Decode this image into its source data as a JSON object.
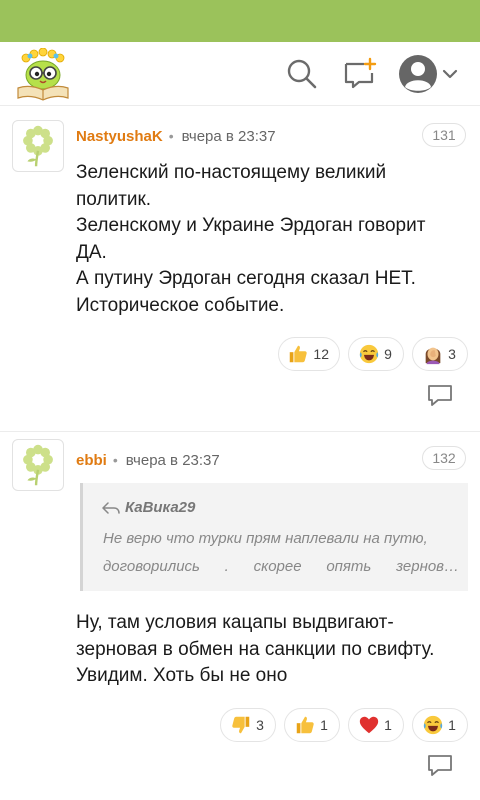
{
  "colors": {
    "top_strip": "#9bc25b",
    "author": "#e07b12",
    "muted": "#888888"
  },
  "header": {
    "logo_icon": "owl-book-logo",
    "search_icon": "search-icon",
    "new_post_icon": "chat-plus-icon",
    "profile_icon": "user-avatar-icon",
    "menu_icon": "chevron-down-icon"
  },
  "comments": [
    {
      "avatar_icon": "flower-avatar",
      "author": "NastyushaK",
      "separator": "•",
      "time": "вчера в 23:37",
      "number": "131",
      "text_lines": [
        "Зеленский по-настоящему великий",
        "политик.",
        "Зеленскому и Украине Эрдоган говорит",
        "ДА.",
        "А путину Эрдоган сегодня сказал НЕТ.",
        "Историческое событие."
      ],
      "reactions": [
        {
          "icon": "thumbs-up-emoji",
          "count": "12"
        },
        {
          "icon": "laughing-emoji",
          "count": "9"
        },
        {
          "icon": "facepalm-emoji",
          "count": "3"
        }
      ],
      "reply_icon": "reply-bubble-icon"
    },
    {
      "avatar_icon": "flower-avatar",
      "author": "ebbi",
      "separator": "•",
      "time": "вчера в 23:37",
      "number": "132",
      "quote": {
        "icon": "reply-arrow-icon",
        "author": "КаВика29",
        "lines": [
          "Не верю что турки прям наплевали на путю,",
          "договорились  .  скорее  опять  зернов…"
        ]
      },
      "text_lines": [
        "Ну, там условия кацапы выдвигают-",
        "зерновая в обмен на санкции по свифту.",
        "Увидим. Хоть бы не оно"
      ],
      "reactions": [
        {
          "icon": "thumbs-down-emoji",
          "count": "3"
        },
        {
          "icon": "thumbs-up-emoji",
          "count": "1"
        },
        {
          "icon": "heart-emoji",
          "count": "1"
        },
        {
          "icon": "laughing-emoji",
          "count": "1"
        }
      ],
      "reply_icon": "reply-bubble-icon"
    }
  ]
}
